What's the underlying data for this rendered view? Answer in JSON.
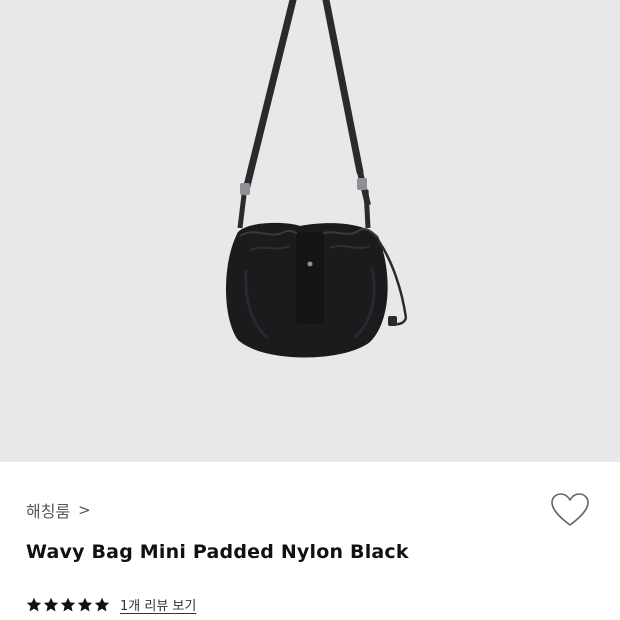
{
  "product": {
    "image_icon": "black-padded-nylon-shoulder-bag",
    "brand": "해칭룸",
    "brand_chevron": ">",
    "title": "Wavy Bag Mini Padded Nylon Black",
    "wishlist_icon": "heart-outline-icon",
    "rating": 5,
    "rating_max": 5,
    "review_link": "1개 리뷰 보기"
  },
  "colors": {
    "hero_background": "#e8e8ea",
    "bag": "#1a1a1c",
    "star": "#111111"
  }
}
